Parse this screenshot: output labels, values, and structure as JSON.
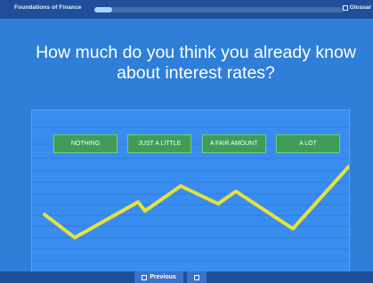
{
  "header": {
    "app_title": "Foundations of Finance",
    "glossary_label": "Glossar",
    "progress_fraction": 0.07
  },
  "main": {
    "question": "How much do you think you already know about interest rates?",
    "options": [
      "NOTHING",
      "JUST A LITTLE",
      "A FAIR AMOUNT",
      "A LOT"
    ]
  },
  "footer": {
    "previous_label": "Previous"
  },
  "colors": {
    "background": "#2f7fd8",
    "bar": "#1f4f9a",
    "option_fill": "#3f9d58",
    "option_border": "#6fd07a",
    "trend_line": "#e7e23a"
  },
  "icons": {
    "glossary": "square-icon",
    "previous": "square-icon",
    "next": "square-icon"
  }
}
